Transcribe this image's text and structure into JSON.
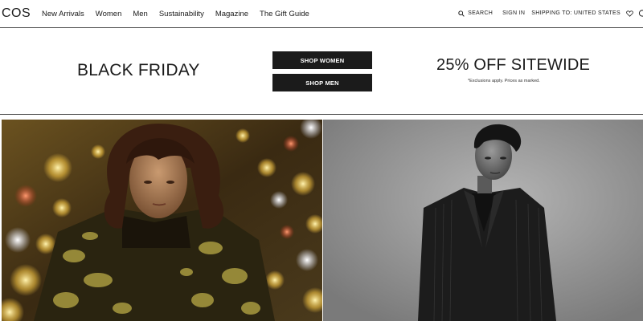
{
  "header": {
    "logo": "COS",
    "nav": [
      "New Arrivals",
      "Women",
      "Men",
      "Sustainability",
      "Magazine",
      "The Gift Guide"
    ],
    "search_label": "SEARCH",
    "sign_in_label": "SIGN IN",
    "shipping_label": "SHIPPING TO: UNITED STATES",
    "icons": [
      "search-icon",
      "heart-icon",
      "bag-icon"
    ]
  },
  "promo": {
    "title": "BLACK FRIDAY",
    "shop_women_label": "SHOP WOMEN",
    "shop_men_label": "SHOP MEN",
    "offer": "25% OFF SITEWIDE",
    "disclaimer": "*Exclusions apply. Prices as marked."
  },
  "colors": {
    "button_bg": "#1b1b1b",
    "button_text": "#ffffff",
    "divider": "#4a4a4a"
  }
}
